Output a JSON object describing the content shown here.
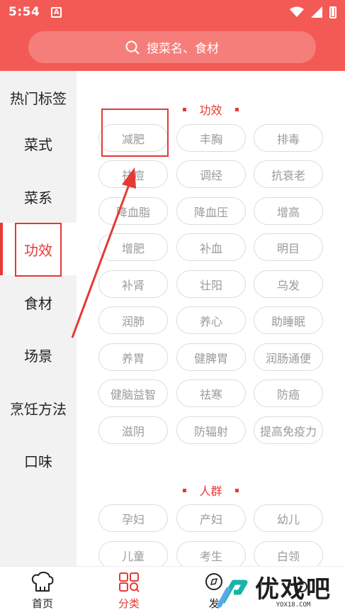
{
  "status": {
    "time": "5:54",
    "notif": "A"
  },
  "search": {
    "placeholder": "搜菜名、食材"
  },
  "sidebar": {
    "items": [
      {
        "label": "热门标签"
      },
      {
        "label": "菜式"
      },
      {
        "label": "菜系"
      },
      {
        "label": "功效"
      },
      {
        "label": "食材"
      },
      {
        "label": "场景"
      },
      {
        "label": "烹饪方法"
      },
      {
        "label": "口味"
      }
    ],
    "active_index": 3
  },
  "sections": [
    {
      "title": "功效",
      "tags": [
        "减肥",
        "丰胸",
        "排毒",
        "祛痘",
        "调经",
        "抗衰老",
        "降血脂",
        "降血压",
        "增高",
        "增肥",
        "补血",
        "明目",
        "补肾",
        "壮阳",
        "乌发",
        "润肺",
        "养心",
        "助睡眠",
        "养胃",
        "健脾胃",
        "润肠通便",
        "健脑益智",
        "祛寒",
        "防癌",
        "滋阴",
        "防辐射",
        "提高免疫力"
      ]
    },
    {
      "title": "人群",
      "tags": [
        "孕妇",
        "产妇",
        "幼儿",
        "儿童",
        "考生",
        "白领"
      ]
    }
  ],
  "tabbar": {
    "items": [
      {
        "label": "首页",
        "icon": "chef-hat-icon"
      },
      {
        "label": "分类",
        "icon": "category-grid-icon"
      },
      {
        "label": "发",
        "icon": "compass-icon"
      },
      {
        "label": "",
        "icon": "person-icon"
      }
    ],
    "active_index": 1
  },
  "watermark": {
    "brand": "优戏吧",
    "url": "YOX18.COM"
  },
  "colors": {
    "accent": "#e83a35",
    "header": "#f45a55",
    "sidebar_bg": "#f2f2f2",
    "tag_text": "#9a9a9a",
    "tag_border": "#dcdcdc"
  }
}
